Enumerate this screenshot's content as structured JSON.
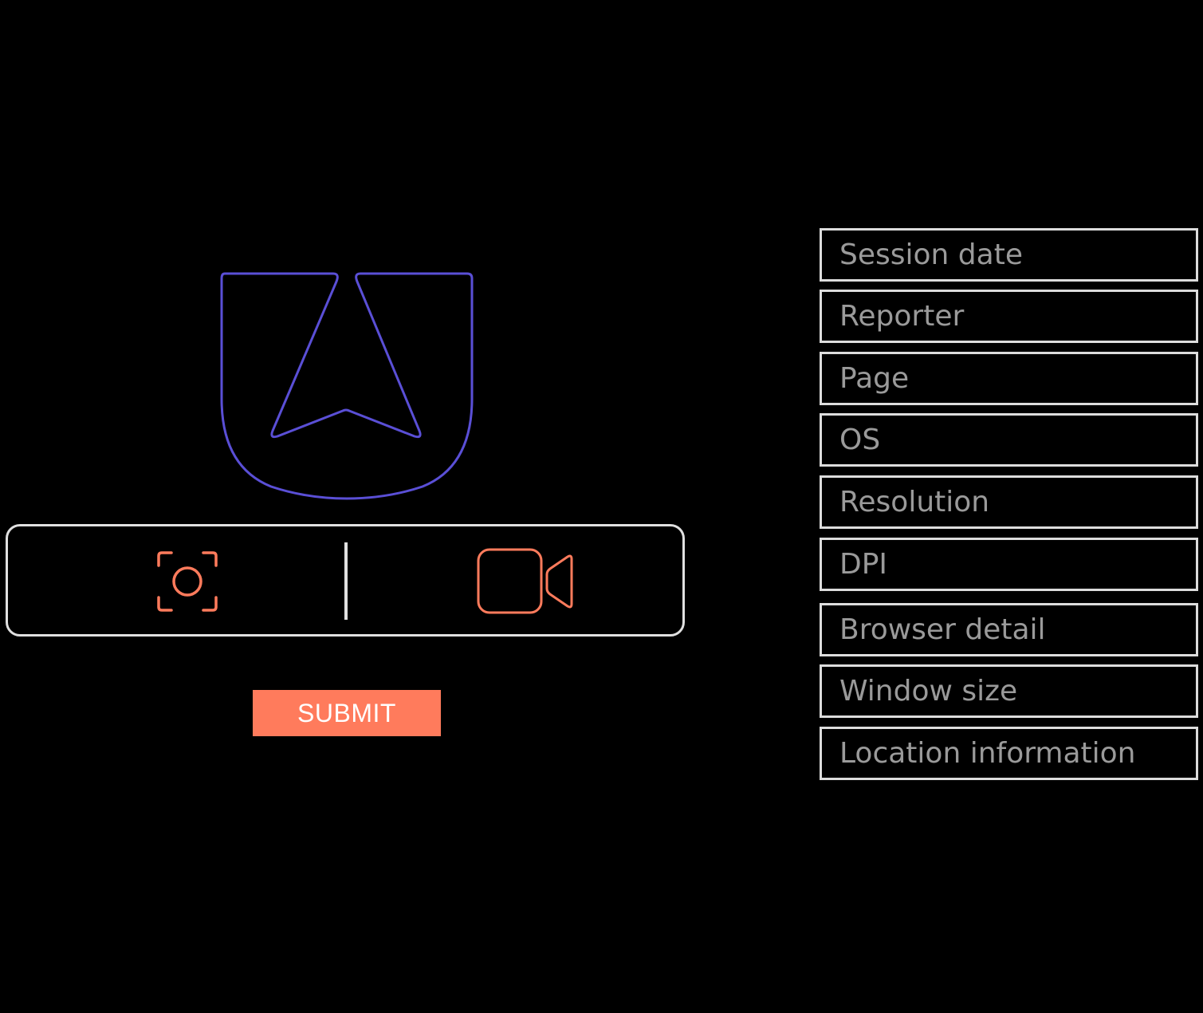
{
  "colors": {
    "background": "#000000",
    "brand_logo": "#5a4fd6",
    "accent": "#ff7b5c",
    "border": "#e0e0e0",
    "field_text": "#9a9a9a"
  },
  "logo": {
    "icon": "brand-logo-icon"
  },
  "capture": {
    "screenshot_icon": "camera-capture-icon",
    "video_icon": "video-camera-icon"
  },
  "form": {
    "submit_label": "SUBMIT"
  },
  "session_info": {
    "fields": [
      "Session date",
      "Reporter",
      "Page",
      "OS",
      "Resolution",
      "DPI",
      "Browser detail",
      "Window size",
      "Location information"
    ]
  }
}
